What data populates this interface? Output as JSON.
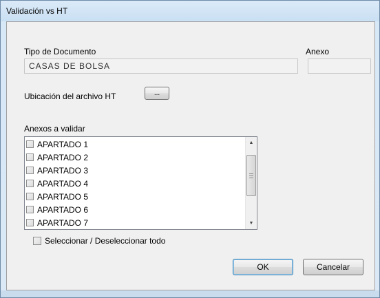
{
  "window": {
    "title": "Validación vs HT"
  },
  "tipo_documento": {
    "label": "Tipo de Documento",
    "value": "CASAS  DE  BOLSA"
  },
  "anexo": {
    "label": "Anexo",
    "value": ""
  },
  "ubicacion": {
    "label": "Ubicación del archivo HT",
    "browse_label": "..."
  },
  "anexos": {
    "label": "Anexos a validar",
    "items": [
      {
        "label": "APARTADO 1",
        "checked": false
      },
      {
        "label": "APARTADO 2",
        "checked": false
      },
      {
        "label": "APARTADO 3",
        "checked": false
      },
      {
        "label": "APARTADO 4",
        "checked": false
      },
      {
        "label": "APARTADO 5",
        "checked": false
      },
      {
        "label": "APARTADO 6",
        "checked": false
      },
      {
        "label": "APARTADO 7",
        "checked": false
      }
    ]
  },
  "select_all": {
    "label": "Seleccionar / Deseleccionar todo",
    "checked": false
  },
  "buttons": {
    "ok": "OK",
    "cancel": "Cancelar"
  },
  "icons": {
    "scroll_up": "scroll-up-arrow-icon",
    "scroll_down": "scroll-down-arrow-icon"
  }
}
